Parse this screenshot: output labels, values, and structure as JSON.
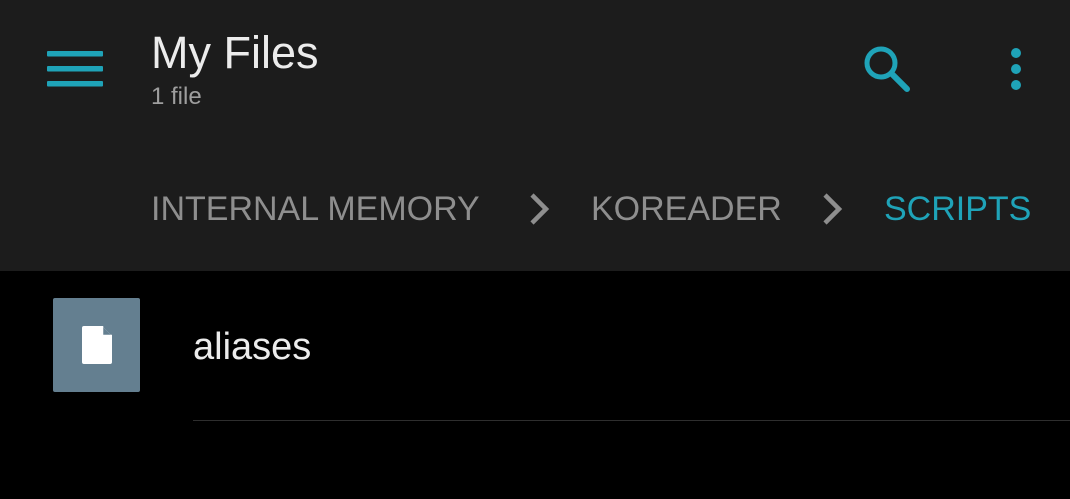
{
  "theme": {
    "accent": "#1fa3b8",
    "appbar_bg": "#1c1c1c",
    "content_bg": "#000000",
    "file_icon_bg": "#647f90"
  },
  "appbar": {
    "menu_icon": "menu-icon",
    "title": "My Files",
    "subtitle": "1 file",
    "search_icon": "search-icon",
    "more_icon": "more-vert-icon"
  },
  "breadcrumb": {
    "items": [
      {
        "label": "INTERNAL MEMORY",
        "active": false
      },
      {
        "label": "KOREADER",
        "active": false
      },
      {
        "label": "SCRIPTS",
        "active": true
      }
    ],
    "separator_icon": "chevron-right-icon"
  },
  "files": [
    {
      "name": "aliases",
      "icon": "file-icon"
    }
  ]
}
